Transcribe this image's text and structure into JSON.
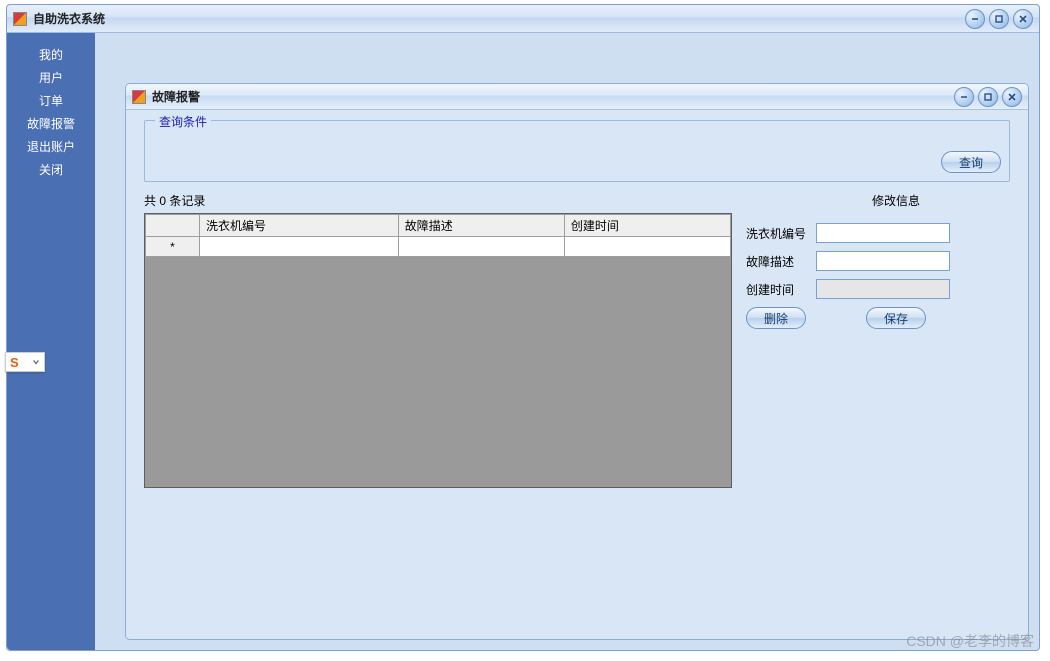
{
  "outer": {
    "title": "自助洗衣系统"
  },
  "sidebar": {
    "items": [
      {
        "label": "我的"
      },
      {
        "label": "用户"
      },
      {
        "label": "订单"
      },
      {
        "label": "故障报警"
      },
      {
        "label": "退出账户"
      },
      {
        "label": "关闭"
      }
    ]
  },
  "inner": {
    "title": "故障报警"
  },
  "query": {
    "groupLabel": "查询条件",
    "searchBtn": "查询"
  },
  "records": {
    "prefix": "共",
    "count": "0",
    "suffix": "条记录"
  },
  "grid": {
    "columns": [
      "洗衣机编号",
      "故障描述",
      "创建时间"
    ],
    "newRowMarker": "*"
  },
  "edit": {
    "title": "修改信息",
    "fields": {
      "machineId": {
        "label": "洗衣机编号",
        "value": ""
      },
      "desc": {
        "label": "故障描述",
        "value": ""
      },
      "created": {
        "label": "创建时间",
        "value": ""
      }
    },
    "deleteBtn": "删除",
    "saveBtn": "保存"
  },
  "ime": {
    "letter": "S"
  },
  "watermark": "CSDN @老李的博客"
}
